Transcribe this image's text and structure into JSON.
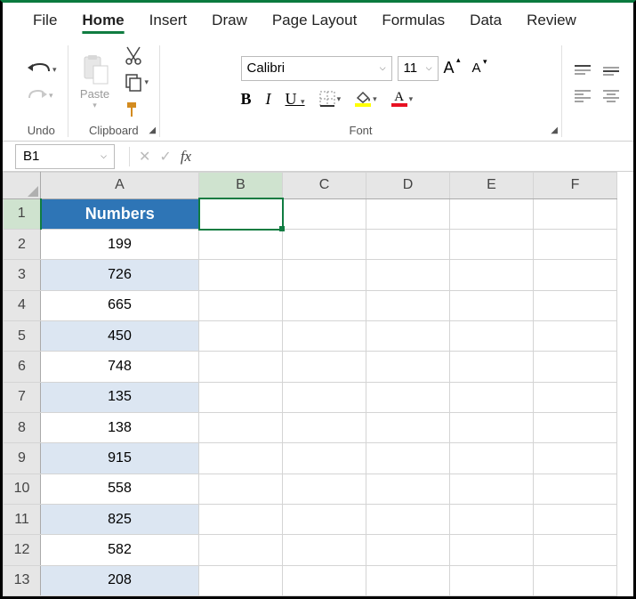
{
  "tabs": [
    "File",
    "Home",
    "Insert",
    "Draw",
    "Page Layout",
    "Formulas",
    "Data",
    "Review"
  ],
  "activeTab": "Home",
  "groups": {
    "undo": "Undo",
    "clipboard": "Clipboard",
    "paste": "Paste",
    "font": "Font"
  },
  "font": {
    "name": "Calibri",
    "size": "11"
  },
  "buttons": {
    "bold": "B",
    "italic": "I",
    "underline": "U",
    "grow": "A",
    "shrink": "A"
  },
  "namebox": "B1",
  "fx_label": "fx",
  "formula_value": "",
  "columns": [
    "A",
    "B",
    "C",
    "D",
    "E",
    "F"
  ],
  "rows": [
    "1",
    "2",
    "3",
    "4",
    "5",
    "6",
    "7",
    "8",
    "9",
    "10",
    "11",
    "12",
    "13"
  ],
  "table_header": "Numbers",
  "numbers": [
    199,
    726,
    665,
    450,
    748,
    135,
    138,
    915,
    558,
    825,
    582,
    208
  ],
  "selected_cell": "B1"
}
